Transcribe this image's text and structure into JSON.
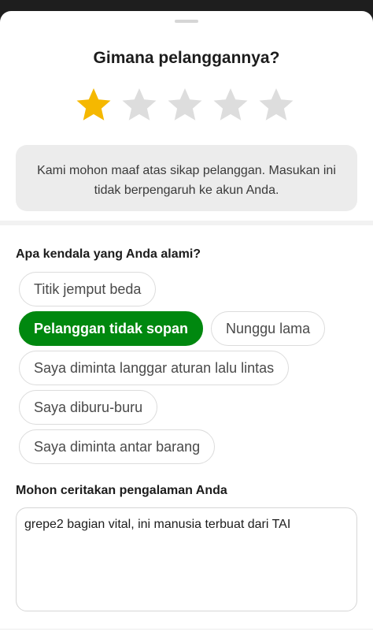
{
  "sheet": {
    "title": "Gimana pelanggannya?"
  },
  "rating": {
    "value": 1,
    "max": 5,
    "filled_color": "#F5B800",
    "empty_color": "#DDDDDD"
  },
  "notice": {
    "text": "Kami mohon maaf atas sikap pelanggan. Masukan ini tidak berpengaruh ke akun Anda."
  },
  "issues": {
    "label": "Apa kendala yang Anda alami?",
    "selected_color": "#00880F",
    "options": [
      {
        "label": "Titik jemput beda",
        "selected": false
      },
      {
        "label": "Pelanggan tidak sopan",
        "selected": true
      },
      {
        "label": "Nunggu lama",
        "selected": false
      },
      {
        "label": "Saya diminta langgar aturan lalu lintas",
        "selected": false
      },
      {
        "label": "Saya diburu-buru",
        "selected": false
      },
      {
        "label": "Saya diminta antar barang",
        "selected": false
      }
    ]
  },
  "story": {
    "label": "Mohon ceritakan pengalaman Anda",
    "value": "grepe2 bagian vital, ini manusia terbuat dari TAI"
  }
}
